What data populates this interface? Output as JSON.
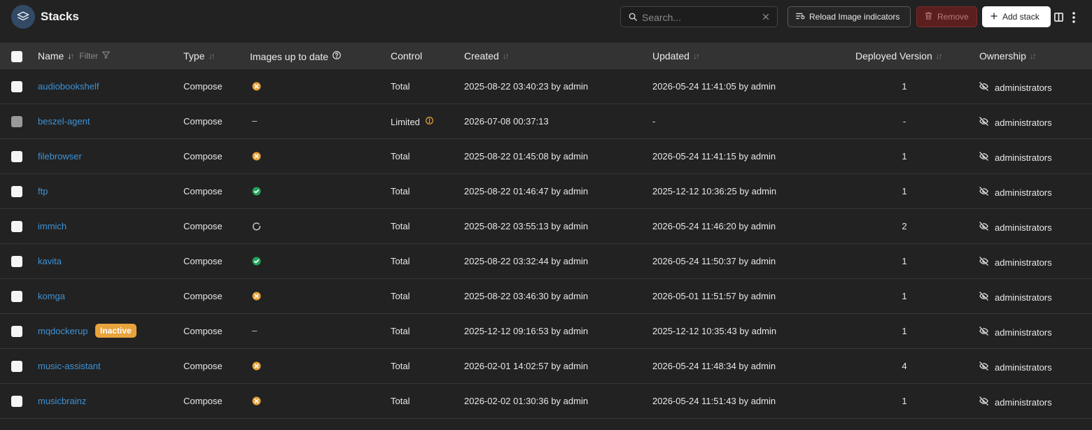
{
  "header": {
    "title": "Stacks",
    "search_placeholder": "Search...",
    "reload_label": "Reload Image indicators",
    "remove_label": "Remove",
    "add_label": "Add stack"
  },
  "columns": {
    "name": "Name",
    "filter": "Filter",
    "type": "Type",
    "images": "Images up to date",
    "control": "Control",
    "created": "Created",
    "updated": "Updated",
    "version": "Deployed Version",
    "ownership": "Ownership"
  },
  "colors": {
    "accent": "#3d92d6",
    "warning": "#e8a33c",
    "ok": "#22a55a",
    "danger": "#5c1f1f"
  },
  "rows": [
    {
      "name": "audiobookshelf",
      "type": "Compose",
      "images": "outdated",
      "control": "Total",
      "created": "2025-08-22 03:40:23 by admin",
      "updated": "2026-05-24 11:41:05 by admin",
      "version": "1",
      "ownership": "administrators"
    },
    {
      "name": "beszel-agent",
      "type": "Compose",
      "images": "none",
      "images_text": "–",
      "control": "Limited",
      "created": "2026-07-08 00:37:13",
      "updated": "-",
      "version": "-",
      "ownership": "administrators"
    },
    {
      "name": "filebrowser",
      "type": "Compose",
      "images": "outdated",
      "control": "Total",
      "created": "2025-08-22 01:45:08 by admin",
      "updated": "2026-05-24 11:41:15 by admin",
      "version": "1",
      "ownership": "administrators"
    },
    {
      "name": "ftp",
      "type": "Compose",
      "images": "uptodate",
      "control": "Total",
      "created": "2025-08-22 01:46:47 by admin",
      "updated": "2025-12-12 10:36:25 by admin",
      "version": "1",
      "ownership": "administrators"
    },
    {
      "name": "immich",
      "type": "Compose",
      "images": "loading",
      "control": "Total",
      "created": "2025-08-22 03:55:13 by admin",
      "updated": "2026-05-24 11:46:20 by admin",
      "version": "2",
      "ownership": "administrators"
    },
    {
      "name": "kavita",
      "type": "Compose",
      "images": "uptodate",
      "control": "Total",
      "created": "2025-08-22 03:32:44 by admin",
      "updated": "2026-05-24 11:50:37 by admin",
      "version": "1",
      "ownership": "administrators"
    },
    {
      "name": "komga",
      "type": "Compose",
      "images": "outdated",
      "control": "Total",
      "created": "2025-08-22 03:46:30 by admin",
      "updated": "2026-05-01 11:51:57 by admin",
      "version": "1",
      "ownership": "administrators"
    },
    {
      "name": "mqdockerup",
      "badge": "Inactive",
      "type": "Compose",
      "images": "none",
      "images_text": "–",
      "control": "Total",
      "created": "2025-12-12 09:16:53 by admin",
      "updated": "2025-12-12 10:35:43 by admin",
      "version": "1",
      "ownership": "administrators"
    },
    {
      "name": "music-assistant",
      "type": "Compose",
      "images": "outdated",
      "control": "Total",
      "created": "2026-02-01 14:02:57 by admin",
      "updated": "2026-05-24 11:48:34 by admin",
      "version": "4",
      "ownership": "administrators"
    },
    {
      "name": "musicbrainz",
      "type": "Compose",
      "images": "outdated",
      "control": "Total",
      "created": "2026-02-02 01:30:36 by admin",
      "updated": "2026-05-24 11:51:43 by admin",
      "version": "1",
      "ownership": "administrators"
    }
  ]
}
